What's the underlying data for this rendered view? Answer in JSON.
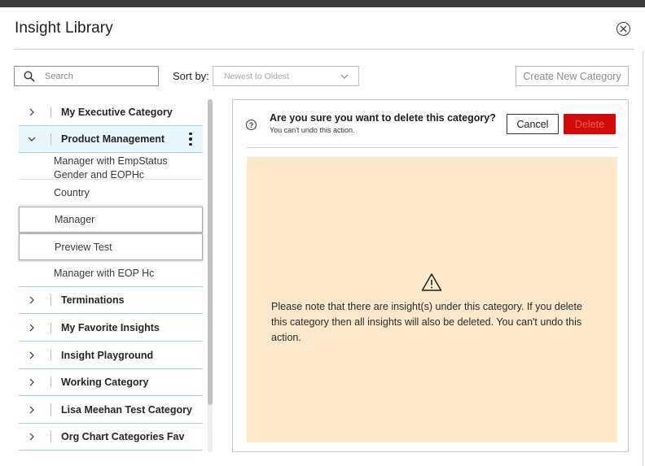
{
  "dialog": {
    "title": "Insight Library",
    "close_icon": "close-circle-icon"
  },
  "toolbar": {
    "search_placeholder": "Search",
    "search_icon": "search-icon",
    "sort_label": "Sort by:",
    "sort_value": "Newest to Oldest",
    "create_label": "Create New Category"
  },
  "tree": {
    "categories": [
      {
        "label": "My Executive Category",
        "expanded": false
      },
      {
        "label": "Product Management",
        "expanded": true,
        "selected": true
      },
      {
        "label": "Terminations",
        "expanded": false
      },
      {
        "label": "My Favorite Insights",
        "expanded": false
      },
      {
        "label": "Insight Playground",
        "expanded": false
      },
      {
        "label": "Working Category",
        "expanded": false
      },
      {
        "label": "Lisa Meehan Test Category",
        "expanded": false
      },
      {
        "label": "Org Chart Categories Fav",
        "expanded": false
      }
    ],
    "insights": [
      {
        "label": "Manager with EmpStatus Gender and EOPHc"
      },
      {
        "label": "Country"
      },
      {
        "label": "Manager"
      },
      {
        "label": "Preview Test"
      },
      {
        "label": "Manager with EOP Hc"
      }
    ]
  },
  "confirm": {
    "title": "Are you sure you want to delete this category?",
    "subtitle": "You can't undo this action.",
    "cancel_label": "Cancel",
    "delete_label": "Delete",
    "warning_icon": "warning-triangle-icon",
    "warning_text": "Please note that there are insight(s) under this category. If you delete this category then all insights will also be deleted. You can't undo this action."
  },
  "colors": {
    "delete_bg": "#d10a0a",
    "warning_bg": "#fde9c9",
    "selected_bg": "#e9f6fb",
    "divider_accent": "#9fd4e0"
  }
}
